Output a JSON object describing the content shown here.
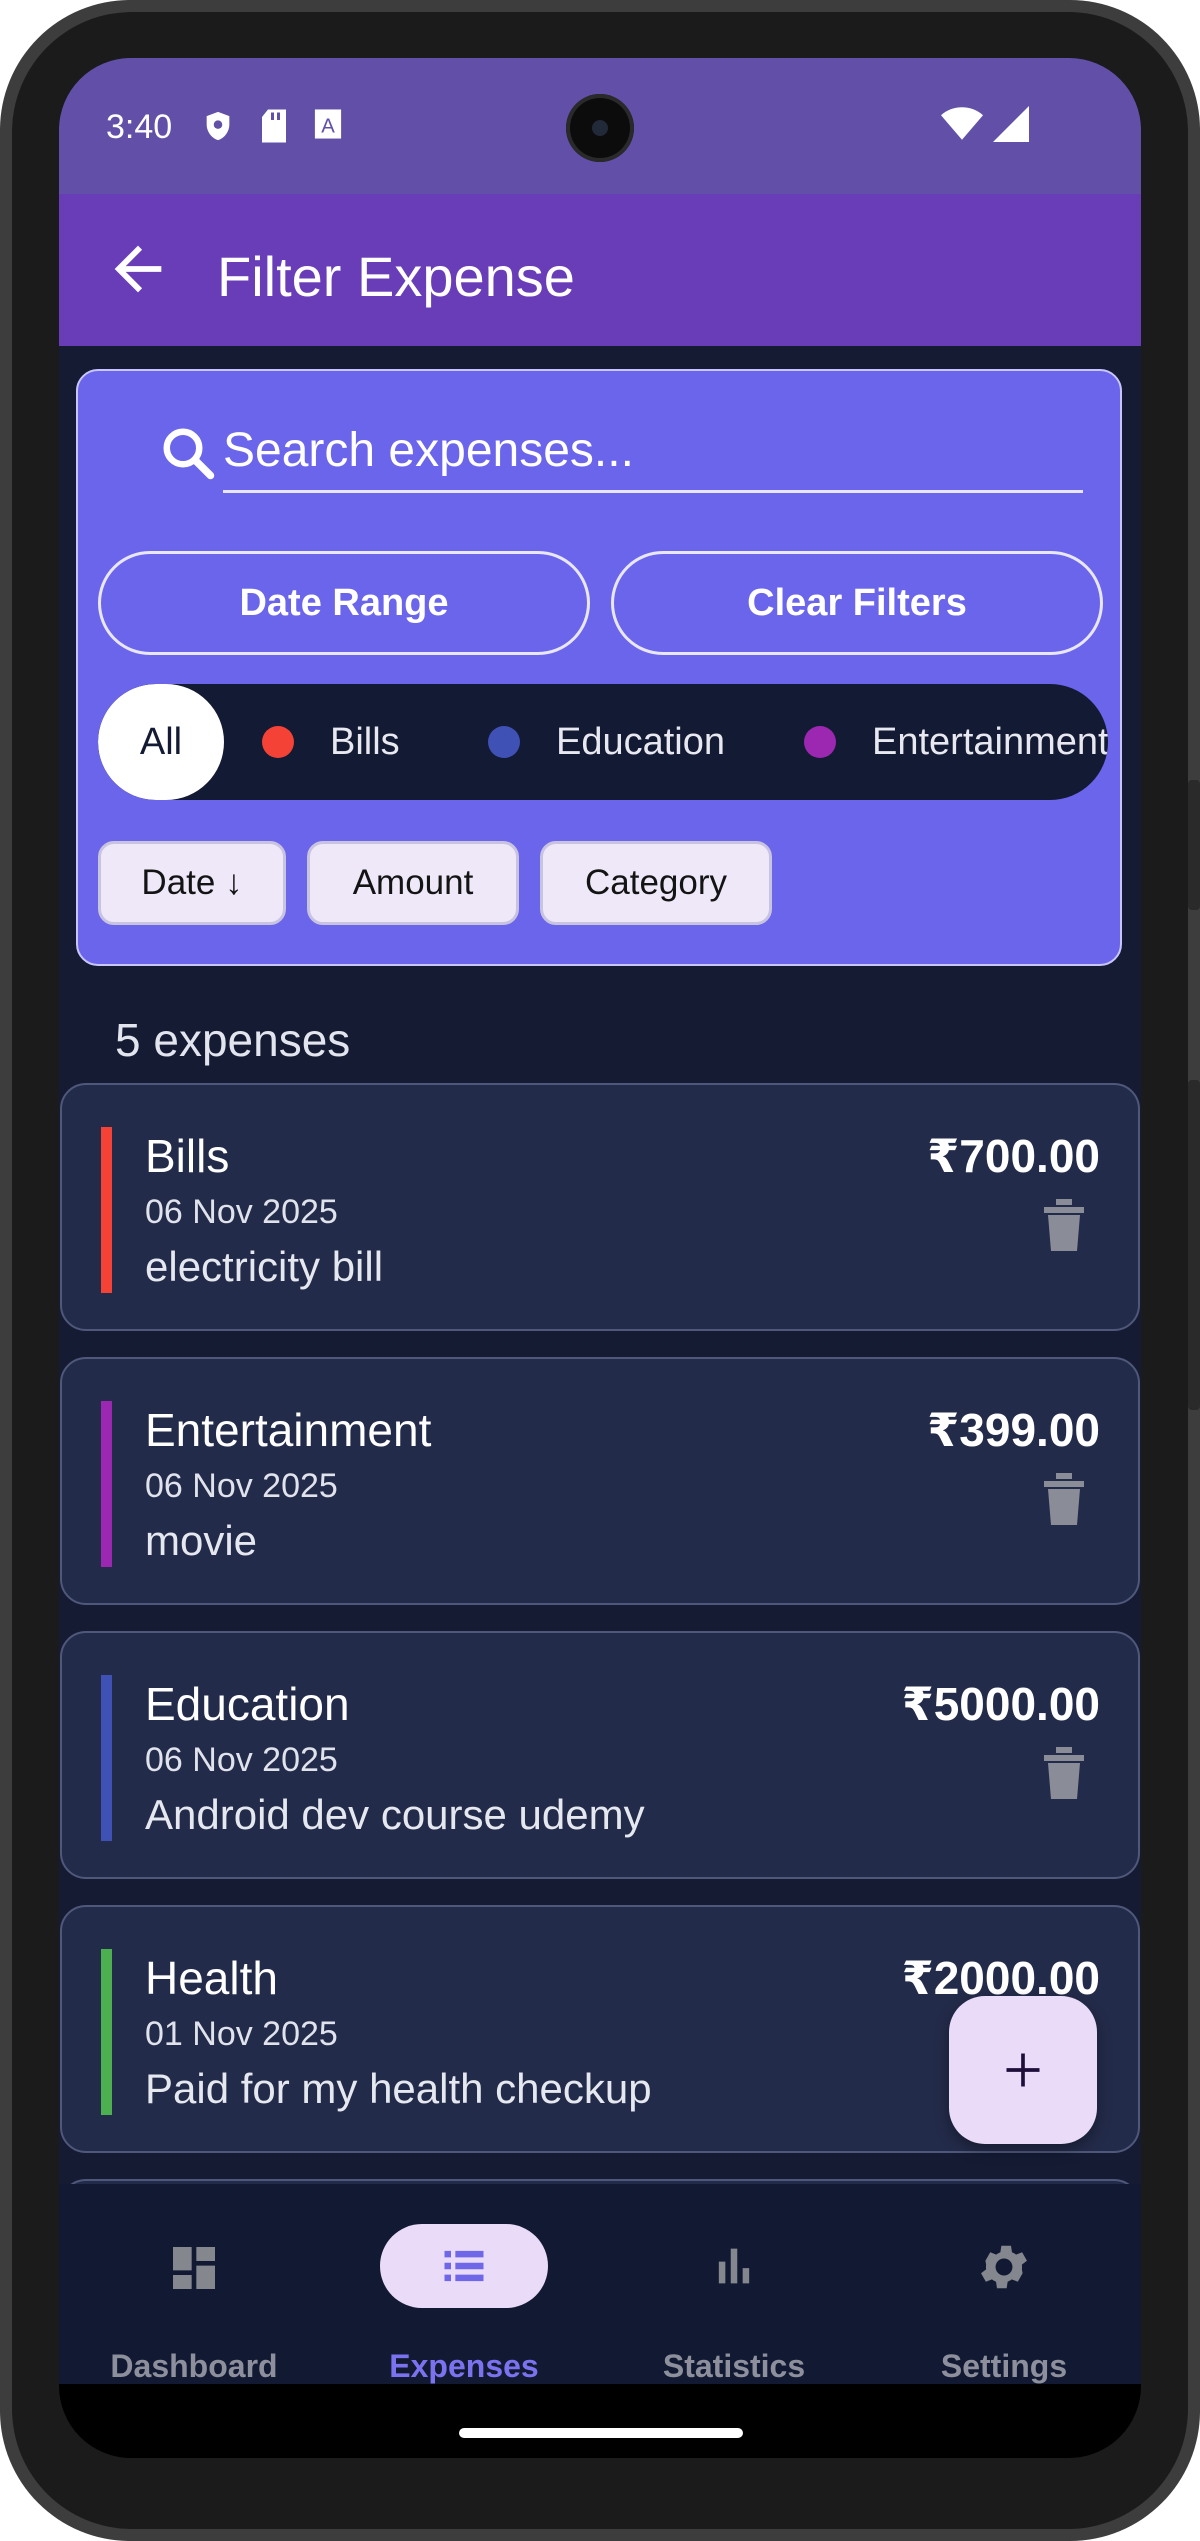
{
  "status_bar": {
    "time": "3:40",
    "icons": [
      "shield-icon",
      "sd-card-icon",
      "font-a-icon",
      "wifi-icon",
      "signal-icon"
    ]
  },
  "app_bar": {
    "title": "Filter Expense",
    "back_icon": "arrow-back-icon",
    "color": "#6a3db8"
  },
  "filter": {
    "search_placeholder": "Search expenses...",
    "date_range_label": "Date Range",
    "clear_filters_label": "Clear Filters",
    "categories": [
      {
        "label": "All",
        "selected": true
      },
      {
        "label": "Bills",
        "color": "#f44336"
      },
      {
        "label": "Education",
        "color": "#3f51b5"
      },
      {
        "label": "Entertainment",
        "color": "#9c27b0"
      }
    ],
    "sort_options": [
      "Date ↓",
      "Amount",
      "Category"
    ],
    "card_color": "#6b65ec"
  },
  "expense_count_label": "5 expenses",
  "expenses": [
    {
      "category": "Bills",
      "date": "06 Nov 2025",
      "note": "electricity bill",
      "amount": "₹700.00",
      "color": "#f44336"
    },
    {
      "category": "Entertainment",
      "date": "06 Nov 2025",
      "note": "movie",
      "amount": "₹399.00",
      "color": "#9c27b0"
    },
    {
      "category": "Education",
      "date": "06 Nov 2025",
      "note": "Android dev course udemy",
      "amount": "₹5000.00",
      "color": "#3f51b5"
    },
    {
      "category": "Health",
      "date": "01 Nov 2025",
      "note": "Paid for my health checkup",
      "amount": "₹2000.00",
      "color": "#4caf50"
    }
  ],
  "fab_icon": "add-icon",
  "bottom_nav": [
    {
      "label": "Dashboard",
      "icon": "dashboard-icon",
      "active": false
    },
    {
      "label": "Expenses",
      "icon": "list-icon",
      "active": true
    },
    {
      "label": "Statistics",
      "icon": "bar-chart-icon",
      "active": false
    },
    {
      "label": "Settings",
      "icon": "gear-icon",
      "active": false
    }
  ]
}
